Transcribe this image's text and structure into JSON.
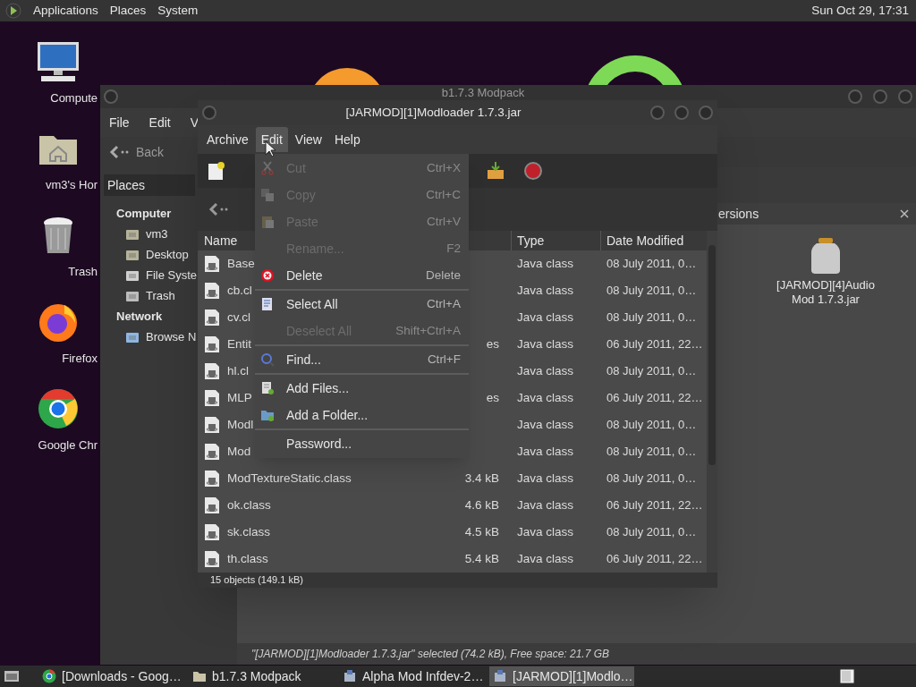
{
  "top_panel": {
    "menus": [
      "Applications",
      "Places",
      "System"
    ],
    "clock": "Sun Oct 29, 17:31"
  },
  "desktop_icons": [
    {
      "label": "Compute",
      "kind": "computer"
    },
    {
      "label": "vm3's Hor",
      "kind": "home"
    },
    {
      "label": "Trash",
      "kind": "trash"
    },
    {
      "label": "Firefox",
      "kind": "firefox"
    },
    {
      "label": "Google Chr",
      "kind": "chrome"
    }
  ],
  "back_window": {
    "title": "b1.7.3 Modpack",
    "menus": [
      "File",
      "Edit",
      "V"
    ],
    "back_button": "Back",
    "dropdown": "Places",
    "sidebar": [
      {
        "heading": "Computer",
        "items": [
          {
            "label": "vm3",
            "kind": "home"
          },
          {
            "label": "Desktop",
            "kind": "desktop"
          },
          {
            "label": "File Syste",
            "kind": "drive"
          },
          {
            "label": "Trash",
            "kind": "trash"
          }
        ]
      },
      {
        "heading": "Network",
        "items": [
          {
            "label": "Browse N",
            "kind": "network"
          }
        ]
      }
    ],
    "tab": "ersions",
    "files": [
      {
        "label": "[JARMOD][4]Audio Mod 1.7.3.jar"
      }
    ],
    "status": "\"[JARMOD][1]Modloader 1.7.3.jar\" selected (74.2 kB), Free space: 21.7 GB"
  },
  "archive_window": {
    "title": "[JARMOD][1]Modloader 1.7.3.jar",
    "menus": [
      {
        "label": "Archive",
        "selected": false
      },
      {
        "label": "Edit",
        "selected": true
      },
      {
        "label": "View",
        "selected": false
      },
      {
        "label": "Help",
        "selected": false
      }
    ],
    "columns": [
      "Name",
      "Type",
      "Date Modified"
    ],
    "rows": [
      {
        "name": "Base",
        "type": "Java class",
        "date": "08 July 2011, 0…"
      },
      {
        "name": "cb.cl",
        "type": "Java class",
        "date": "08 July 2011, 0…"
      },
      {
        "name": "cv.cl",
        "type": "Java class",
        "date": "08 July 2011, 0…"
      },
      {
        "name": "Entit",
        "size": "es",
        "type": "Java class",
        "date": "06 July 2011, 22…"
      },
      {
        "name": "hl.cl",
        "type": "Java class",
        "date": "08 July 2011, 0…"
      },
      {
        "name": "MLP",
        "size": "es",
        "type": "Java class",
        "date": "06 July 2011, 22…"
      },
      {
        "name": "Modl",
        "type": "Java class",
        "date": "08 July 2011, 0…"
      },
      {
        "name": "Mod",
        "type": "Java class",
        "date": "08 July 2011, 0…"
      },
      {
        "name": "ModTextureStatic.class",
        "size": "3.4 kB",
        "type": "Java class",
        "date": "08 July 2011, 0…"
      },
      {
        "name": "ok.class",
        "size": "4.6 kB",
        "type": "Java class",
        "date": "06 July 2011, 22…"
      },
      {
        "name": "sk.class",
        "size": "4.5 kB",
        "type": "Java class",
        "date": "08 July 2011, 0…"
      },
      {
        "name": "th.class",
        "size": "5.4 kB",
        "type": "Java class",
        "date": "06 July 2011, 22…"
      }
    ],
    "status": "15 objects (149.1 kB)"
  },
  "edit_menu": [
    {
      "kind": "cut",
      "label": "Cut",
      "shortcut": "Ctrl+X",
      "disabled": true
    },
    {
      "kind": "copy",
      "label": "Copy",
      "shortcut": "Ctrl+C",
      "disabled": true
    },
    {
      "kind": "paste",
      "label": "Paste",
      "shortcut": "Ctrl+V",
      "disabled": true
    },
    {
      "kind": "plain",
      "label": "Rename...",
      "shortcut": "F2",
      "disabled": true
    },
    {
      "kind": "delete",
      "label": "Delete",
      "shortcut": "Delete",
      "disabled": false
    },
    {
      "kind": "separator"
    },
    {
      "kind": "select",
      "label": "Select All",
      "shortcut": "Ctrl+A",
      "disabled": false
    },
    {
      "kind": "plain",
      "label": "Deselect All",
      "shortcut": "Shift+Ctrl+A",
      "disabled": true
    },
    {
      "kind": "separator"
    },
    {
      "kind": "find",
      "label": "Find...",
      "shortcut": "Ctrl+F",
      "disabled": false
    },
    {
      "kind": "separator"
    },
    {
      "kind": "addfiles",
      "label": "Add Files...",
      "disabled": false
    },
    {
      "kind": "addfolder",
      "label": "Add a Folder...",
      "disabled": false
    },
    {
      "kind": "separator"
    },
    {
      "kind": "plain",
      "label": "Password...",
      "disabled": false
    }
  ],
  "taskbar": [
    {
      "label": "[Downloads - Goog…",
      "kind": "chrome",
      "selected": false
    },
    {
      "label": "b1.7.3 Modpack",
      "kind": "folder",
      "selected": false
    },
    {
      "label": "Alpha Mod Infdev-2…",
      "kind": "archive",
      "selected": false
    },
    {
      "label": "[JARMOD][1]Modlo…",
      "kind": "archive",
      "selected": true
    }
  ]
}
